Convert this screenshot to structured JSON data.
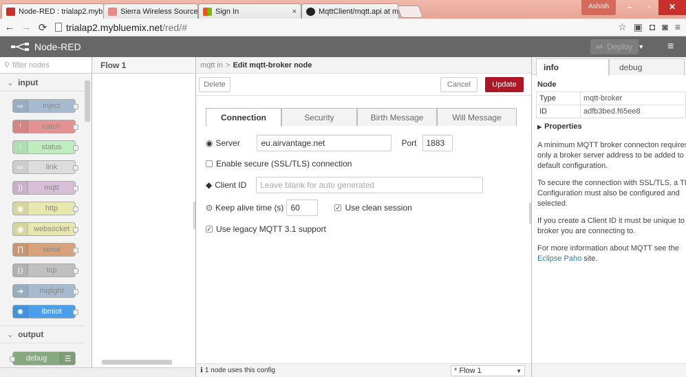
{
  "browser": {
    "tabs": [
      {
        "title": "Node-RED : trialap2.mybl",
        "close": "×"
      },
      {
        "title": "Sierra Wireless Source",
        "close": "×"
      },
      {
        "title": "Sign In",
        "close": "×"
      },
      {
        "title": "MqttClient/mqtt.api at m",
        "close": "×"
      }
    ],
    "user": "Ashish",
    "url_host": "trialap2.mybluemix.net",
    "url_path": "/red/#"
  },
  "header": {
    "app_name": "Node-RED",
    "deploy_label": "Deploy"
  },
  "palette": {
    "filter_placeholder": "filter nodes",
    "categories": [
      "input",
      "output"
    ],
    "nodes": [
      {
        "label": "inject",
        "color": "#a6bbcf"
      },
      {
        "label": "catch",
        "color": "#e49191"
      },
      {
        "label": "status",
        "color": "#c0edc0"
      },
      {
        "label": "link",
        "color": "#dddddd"
      },
      {
        "label": "mqtt",
        "color": "#d8bfd8"
      },
      {
        "label": "http",
        "color": "#e7e7ae"
      },
      {
        "label": "websocket",
        "color": "#e7e7ae"
      },
      {
        "label": "serial",
        "color": "#d8a37a"
      },
      {
        "label": "tcp",
        "color": "#c0c0c0"
      },
      {
        "label": "mqlight",
        "color": "#a6bbcf"
      },
      {
        "label": "ibmiot",
        "color": "#4a9eeb"
      },
      {
        "label": "debug",
        "color": "#87a980"
      }
    ]
  },
  "workspace": {
    "tab": "Flow 1"
  },
  "editor": {
    "breadcrumb_parent": "mqtt in",
    "breadcrumb_sep": ">",
    "title": "Edit mqtt-broker node",
    "delete_label": "Delete",
    "cancel_label": "Cancel",
    "update_label": "Update",
    "tabs": [
      "Connection",
      "Security",
      "Birth Message",
      "Will Message"
    ],
    "server_label": "Server",
    "server_value": "eu.airvantage.net",
    "port_label": "Port",
    "port_value": "1883",
    "tls_label": "Enable secure (SSL/TLS) connection",
    "clientid_label": "Client ID",
    "clientid_placeholder": "Leave blank for auto generated",
    "keepalive_label": "Keep alive time (s)",
    "keepalive_value": "60",
    "clean_session_label": "Use clean session",
    "legacy_label": "Use legacy MQTT 3.1 support",
    "footer_text": "1 node uses this config",
    "flow_select": "* Flow 1"
  },
  "sidebar": {
    "tabs": [
      "info",
      "debug"
    ],
    "section": "Node",
    "rows": [
      {
        "key": "Type",
        "value": "mqtt-broker"
      },
      {
        "key": "ID",
        "value": "adfb3bed.f65ee8"
      }
    ],
    "properties": "Properties",
    "desc": [
      "A minimum MQTT broker connecton requires",
      "only a broker server address to be added to th",
      "default configuration.",
      "To secure the connection with SSL/TLS, a TLS",
      "Configuration must also be configured and",
      "selected.",
      "If you create a Client ID it must be unique to th",
      "broker you are connecting to.",
      "For more information about MQTT see the"
    ],
    "link_text": "Eclipse Paho",
    "link_suffix": " site."
  },
  "colors": {
    "accent": "#ad1625",
    "header": "#676767"
  }
}
